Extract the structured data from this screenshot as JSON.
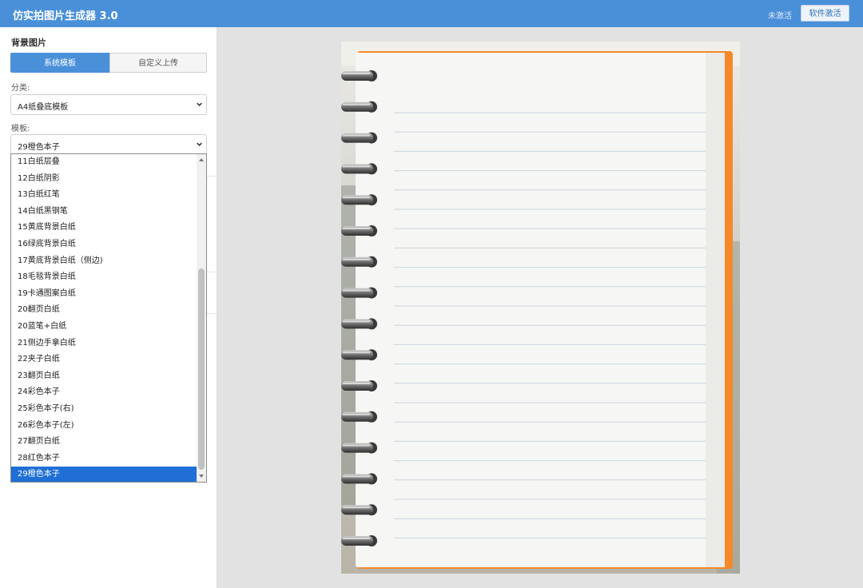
{
  "app": {
    "title": "仿实拍图片生成器 3.0",
    "activation_status": "未激活",
    "activate_button": "软件激活"
  },
  "sidebar": {
    "section_heading": "背景图片",
    "tabs": [
      {
        "label": "系统模板",
        "active": true
      },
      {
        "label": "自定义上传",
        "active": false
      }
    ],
    "category_label": "分类:",
    "category_value": "A4纸叠底模板",
    "template_label": "模板:",
    "template_value": "29橙色本子",
    "template_options": [
      "11白纸层叠",
      "12白纸阴影",
      "13白纸红笔",
      "14白纸黑钢笔",
      "15黄底背景白纸",
      "16绿底背景白纸",
      "17黄底背景白纸（侧边)",
      "18毛毯背景白纸",
      "19卡通图案白纸",
      "20翻页白纸",
      "20蓝笔+白纸",
      "21侧边手拿白纸",
      "22夹子白纸",
      "23翻页白纸",
      "24彩色本子",
      "25彩色本子(右)",
      "26彩色本子(左)",
      "27翻页白纸",
      "28红色本子",
      "29橙色本子"
    ],
    "selected_option_index": 19
  },
  "icons": {
    "select_chevron": "chevron-down-icon",
    "scroll_up": "scroll-up-arrow-icon",
    "scroll_down": "scroll-down-arrow-icon"
  },
  "colors": {
    "accent": "#4a90d9",
    "selection": "#1f6fd6",
    "notebook_cover": "#f5892a",
    "page": "#f6f6f4",
    "rule_line": "#c9d4e2"
  }
}
